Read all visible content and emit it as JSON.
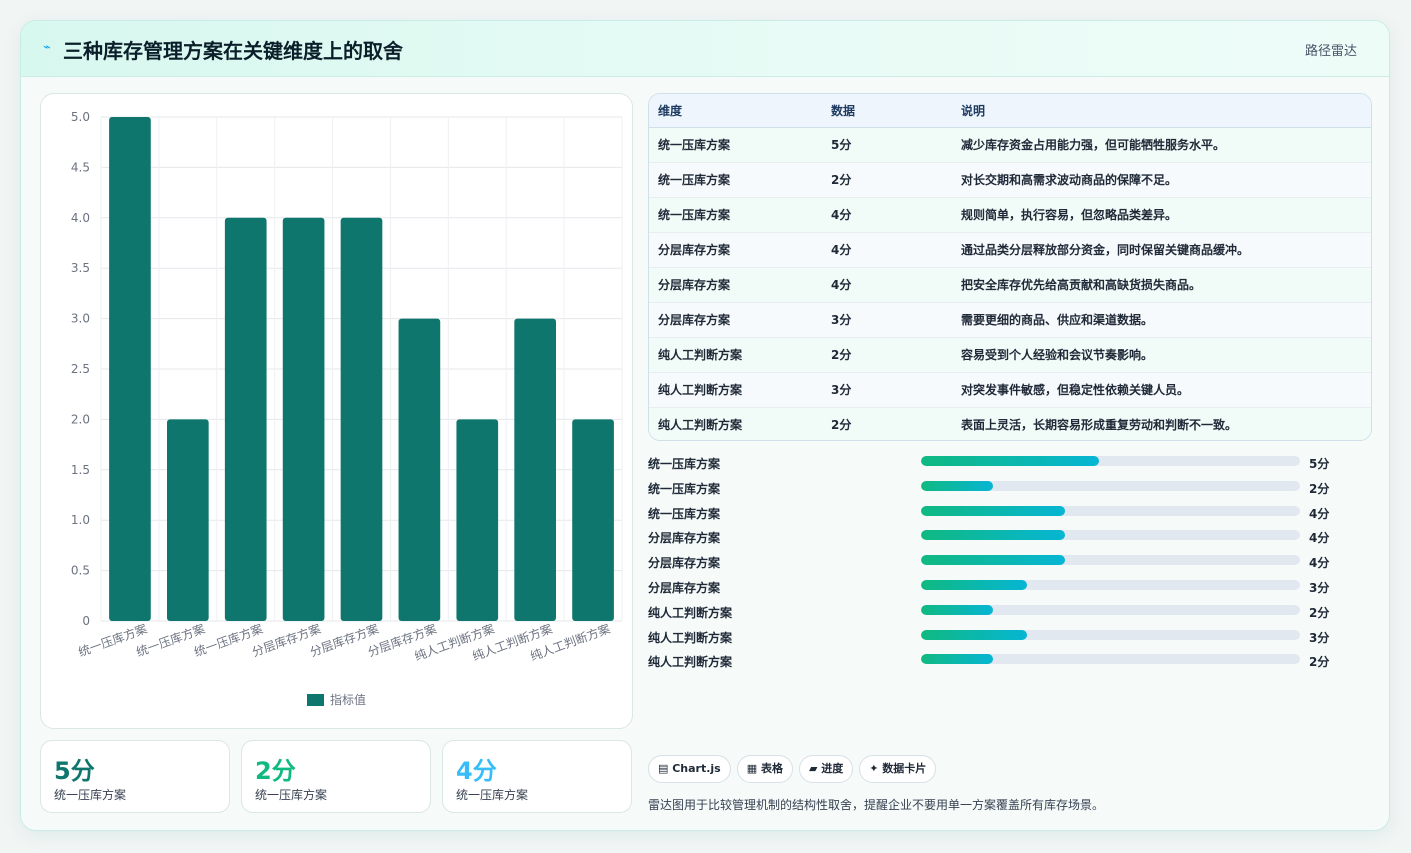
{
  "header": {
    "icon": "⌁",
    "title": "三种库存管理方案在关键维度上的取舍",
    "tag": "路径雷达"
  },
  "chart_data": {
    "type": "bar",
    "categories": [
      "统一压库方案",
      "统一压库方案",
      "统一压库方案",
      "分层库存方案",
      "分层库存方案",
      "分层库存方案",
      "纯人工判断方案",
      "纯人工判断方案",
      "纯人工判断方案"
    ],
    "series": [
      {
        "name": "指标值",
        "values": [
          5,
          2,
          4,
          4,
          4,
          3,
          2,
          3,
          2
        ],
        "color": "#0f766e"
      }
    ],
    "ylim": [
      0,
      5
    ],
    "yticks": [
      "0",
      "0.5",
      "1.0",
      "1.5",
      "2.0",
      "2.5",
      "3.0",
      "3.5",
      "4.0",
      "4.5",
      "5.0"
    ],
    "grid": true,
    "legend": "bottom"
  },
  "kpis": [
    {
      "value": "5分",
      "label": "统一压库方案",
      "color": "#0f766e"
    },
    {
      "value": "2分",
      "label": "统一压库方案",
      "color": "#10b981"
    },
    {
      "value": "4分",
      "label": "统一压库方案",
      "color": "#38bdf8"
    }
  ],
  "table": {
    "headers": [
      "维度",
      "数据",
      "说明"
    ],
    "rows": [
      [
        "统一压库方案",
        "5分",
        "减少库存资金占用能力强，但可能牺牲服务水平。"
      ],
      [
        "统一压库方案",
        "2分",
        "对长交期和高需求波动商品的保障不足。"
      ],
      [
        "统一压库方案",
        "4分",
        "规则简单，执行容易，但忽略品类差异。"
      ],
      [
        "分层库存方案",
        "4分",
        "通过品类分层释放部分资金，同时保留关键商品缓冲。"
      ],
      [
        "分层库存方案",
        "4分",
        "把安全库存优先给高贡献和高缺货损失商品。"
      ],
      [
        "分层库存方案",
        "3分",
        "需要更细的商品、供应和渠道数据。"
      ],
      [
        "纯人工判断方案",
        "2分",
        "容易受到个人经验和会议节奏影响。"
      ],
      [
        "纯人工判断方案",
        "3分",
        "对突发事件敏感，但稳定性依赖关键人员。"
      ],
      [
        "纯人工判断方案",
        "2分",
        "表面上灵活，长期容易形成重复劳动和判断不一致。"
      ]
    ]
  },
  "progress": [
    {
      "label": "统一压库方案",
      "value": "5分",
      "fraction": 0.47
    },
    {
      "label": "统一压库方案",
      "value": "2分",
      "fraction": 0.19
    },
    {
      "label": "统一压库方案",
      "value": "4分",
      "fraction": 0.38
    },
    {
      "label": "分层库存方案",
      "value": "4分",
      "fraction": 0.38
    },
    {
      "label": "分层库存方案",
      "value": "4分",
      "fraction": 0.38
    },
    {
      "label": "分层库存方案",
      "value": "3分",
      "fraction": 0.28
    },
    {
      "label": "纯人工判断方案",
      "value": "2分",
      "fraction": 0.19
    },
    {
      "label": "纯人工判断方案",
      "value": "3分",
      "fraction": 0.28
    },
    {
      "label": "纯人工判断方案",
      "value": "2分",
      "fraction": 0.19
    }
  ],
  "chips": [
    "▤ Chart.js",
    "▦ 表格",
    "▰ 进度",
    "✦ 数据卡片"
  ],
  "note": "雷达图用于比较管理机制的结构性取舍，提醒企业不要用单一方案覆盖所有库存场景。"
}
